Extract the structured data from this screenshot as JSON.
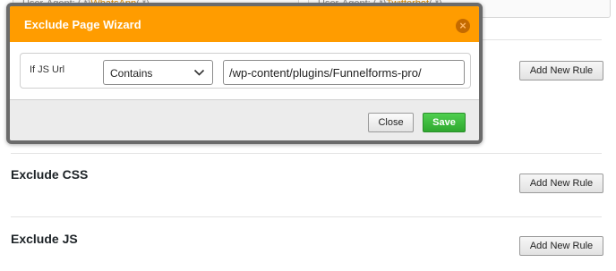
{
  "background": {
    "user_agent_cards": [
      {
        "prefix": "User-Agent: (.*)",
        "highlight": "WhatsApp",
        "suffix": "(.*)"
      },
      {
        "prefix": "User-Agent: (.*)",
        "highlight": "Twitterbot",
        "suffix": "(.*)"
      }
    ],
    "sections": [
      {
        "title": "",
        "button_label": "Add New Rule"
      },
      {
        "title": "Exclude CSS",
        "button_label": "Add New Rule"
      },
      {
        "title": "Exclude JS",
        "button_label": "Add New Rule"
      }
    ]
  },
  "modal": {
    "title": "Exclude Page Wizard",
    "close_icon": "×",
    "rule": {
      "label": "If JS Url",
      "condition": "Contains",
      "value": "/wp-content/plugins/Funnelforms-pro/"
    },
    "footer": {
      "close_label": "Close",
      "save_label": "Save"
    }
  },
  "colors": {
    "header": "#ff9c00",
    "save": "#36b336"
  }
}
